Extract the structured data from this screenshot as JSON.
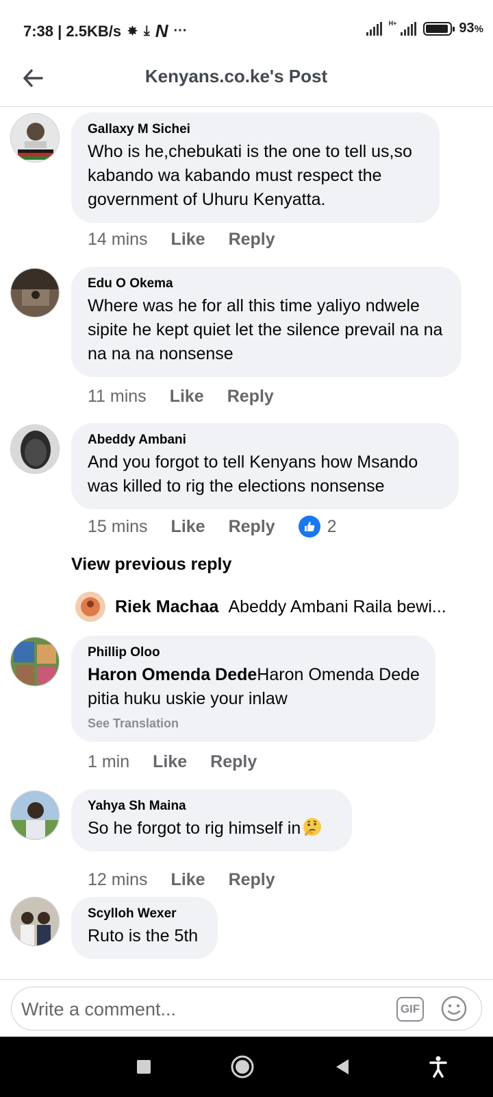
{
  "status_bar": {
    "time": "7:38 | 2.5KB/s",
    "network_type": "H+",
    "battery": "93",
    "battery_unit": "%",
    "battery_level": 0.93
  },
  "header": {
    "title": "Kenyans.co.ke's Post"
  },
  "comments": [
    {
      "author": "Gallaxy M Sichei",
      "text": "Who is he,chebukati is the one to tell us,so kabando wa kabando must respect the government of Uhuru Kenyatta.",
      "time": "14 mins",
      "like": "Like",
      "reply": "Reply"
    },
    {
      "author": "Edu O Okema",
      "text": "Where was he for all this time yaliyo ndwele sipite he kept quiet let the silence prevail  na na na na na nonsense",
      "time": "11 mins",
      "like": "Like",
      "reply": "Reply"
    },
    {
      "author": "Abeddy Ambani",
      "text": "And you forgot to tell Kenyans how Msando was killed to rig the elections nonsense",
      "time": "15 mins",
      "like": "Like",
      "reply": "Reply",
      "reaction_count": "2",
      "reaction_icon": "thumbs-up-icon"
    },
    {
      "author": "Phillip Oloo",
      "mention": "Haron Omenda Dede",
      "text": "Haron Omenda Dede pitia huku uskie your inlaw",
      "see_translation": "See Translation",
      "time": "1 min",
      "like": "Like",
      "reply": "Reply"
    },
    {
      "author": "Yahya Sh Maina",
      "text": "So he forgot to rig himself in",
      "emoji": "thinking-face-icon",
      "time": "12 mins",
      "like": "Like",
      "reply": "Reply"
    },
    {
      "author": "Scylloh Wexer",
      "text": "Ruto is the 5th"
    }
  ],
  "replies": {
    "view_previous": "View previous reply",
    "preview_author": "Riek Machaa",
    "preview_text": "Abeddy Ambani Raila bewi..."
  },
  "composer": {
    "placeholder": "Write a comment...",
    "gif_label": "GIF"
  },
  "colors": {
    "bubble": "#f0f2f5",
    "meta_text": "#65676b",
    "like_blue": "#1877f2"
  }
}
